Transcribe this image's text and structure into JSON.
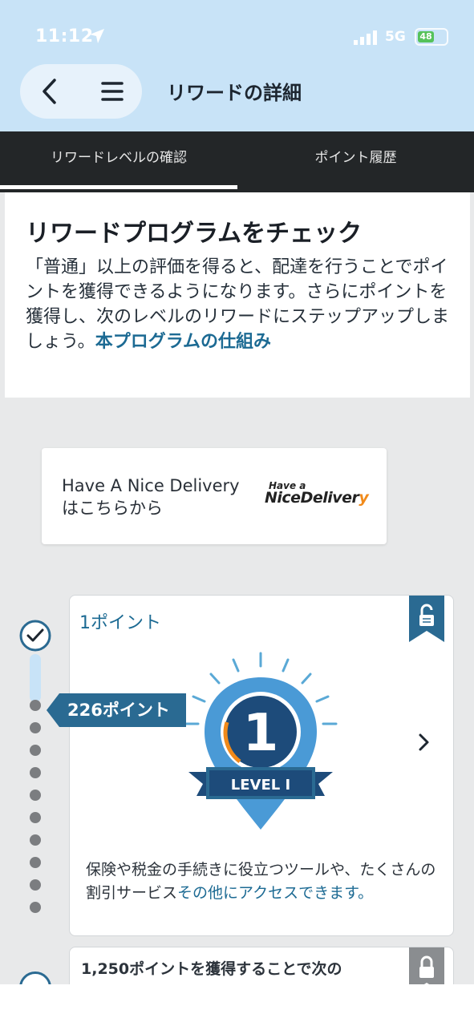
{
  "status_bar": {
    "time": "11:12",
    "network": "5G",
    "battery": "48"
  },
  "header": {
    "title": "リワードの詳細"
  },
  "tabs": [
    {
      "label": "リワードレベルの確認",
      "selected": true
    },
    {
      "label": "ポイント履歴",
      "selected": false
    }
  ],
  "intro": {
    "title": "リワードプログラムをチェック",
    "body": "「普通」以上の評価を得ると、配達を行うことでポイントを獲得できるようになります。さらにポイントを獲得し、次のレベルのリワードにステップアップしましょう。",
    "link": "本プログラムの仕組み"
  },
  "have_nice_delivery": {
    "line1": "Have A Nice Delivery",
    "line2": "はこちらから",
    "logo_small": "Have a",
    "logo_big_main": "NiceDeliver",
    "logo_big_tail": "y"
  },
  "current_points_tag": "226ポイント",
  "level_card": {
    "points": "1ポイント",
    "level_number": "1",
    "level_label": "LEVEL I",
    "description": "保険や税金の手続きに役立つツールや、たくさんの割引サービス",
    "description_link": "その他にアクセスできます。"
  },
  "next_card": {
    "text": "1,250ポイントを獲得することで次の"
  },
  "colors": {
    "header_bg": "#c8e3f7",
    "tab_bar_bg": "#232628",
    "accent_blue": "#2a6a92",
    "link_blue": "#1c6a93",
    "badge_orange": "#f18a1a"
  }
}
